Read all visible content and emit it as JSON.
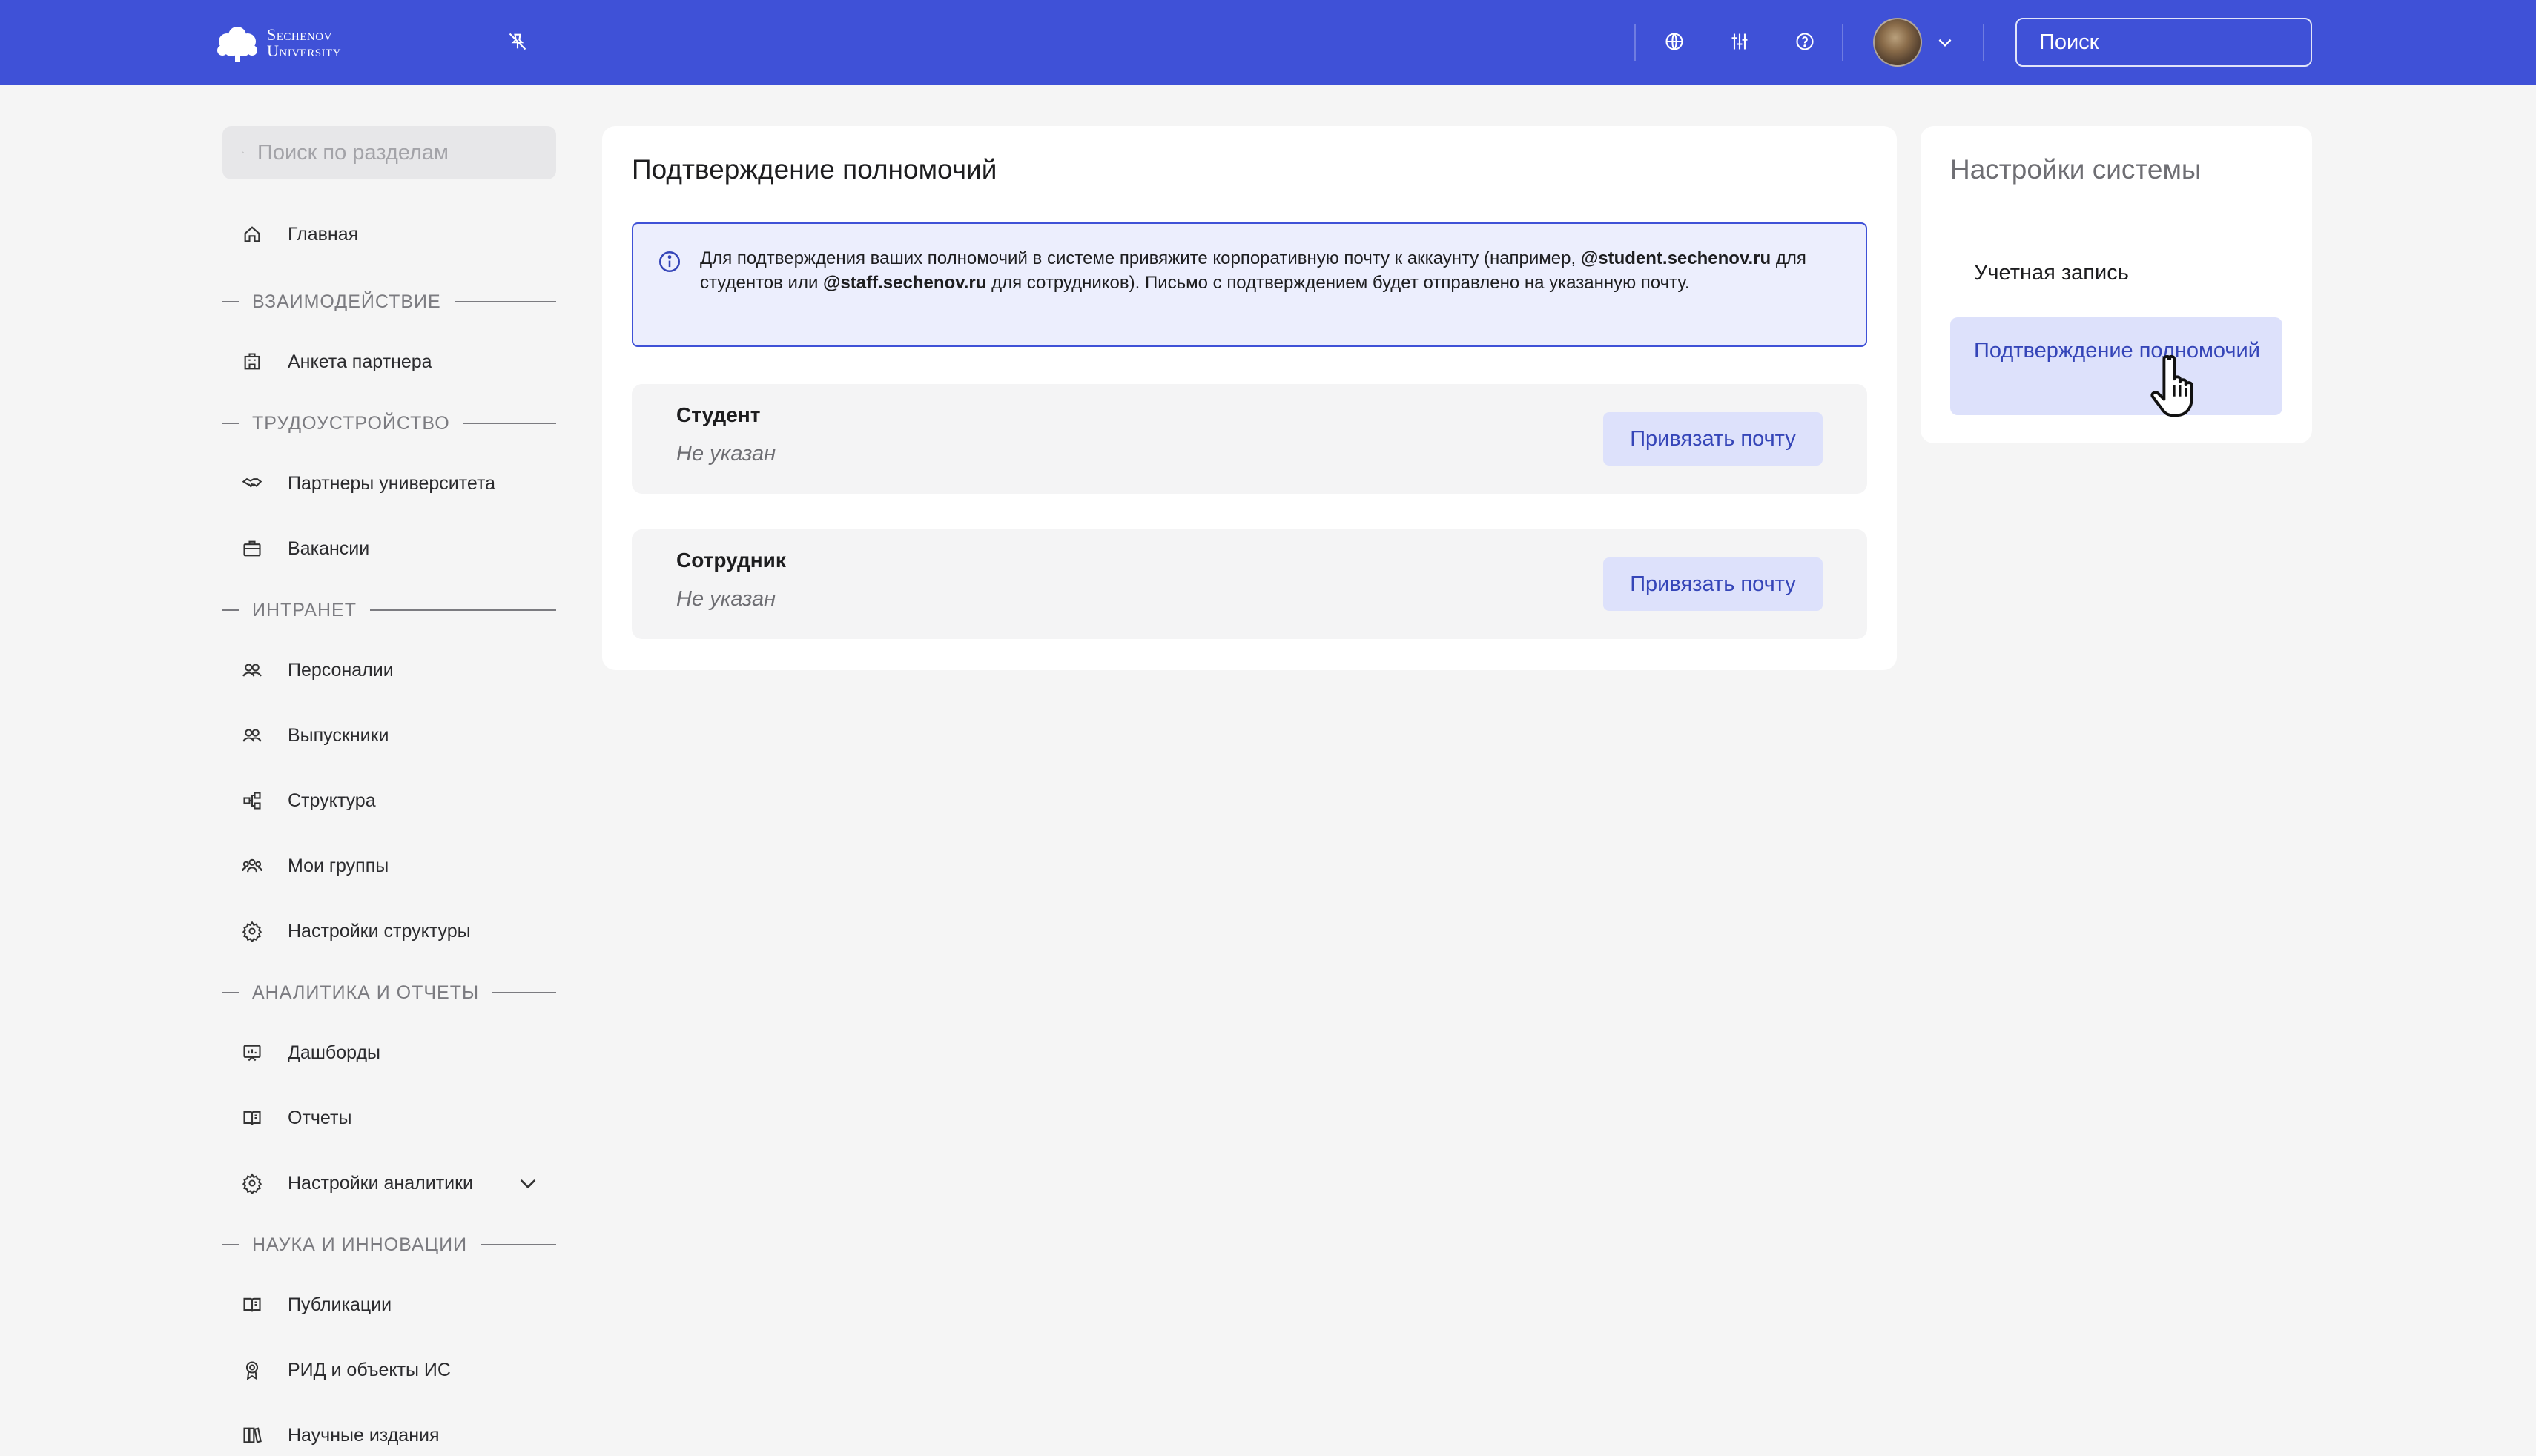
{
  "header": {
    "logo_line1": "Sechenov",
    "logo_line2": "University",
    "search_placeholder": "Поиск",
    "accent_color": "#3f51d7"
  },
  "sidebar": {
    "search_placeholder": "Поиск по разделам",
    "home": {
      "label": "Главная",
      "icon": "home-icon"
    },
    "sections": [
      {
        "title": "ВЗАИМОДЕЙСТВИЕ",
        "items": [
          {
            "label": "Анкета партнера",
            "icon": "building-icon"
          }
        ]
      },
      {
        "title": "ТРУДОУСТРОЙСТВО",
        "items": [
          {
            "label": "Партнеры университета",
            "icon": "handshake-icon"
          },
          {
            "label": "Вакансии",
            "icon": "briefcase-icon"
          }
        ]
      },
      {
        "title": "ИНТРАНЕТ",
        "items": [
          {
            "label": "Персоналии",
            "icon": "people-icon"
          },
          {
            "label": "Выпускники",
            "icon": "people-icon"
          },
          {
            "label": "Структура",
            "icon": "structure-icon"
          },
          {
            "label": "Мои группы",
            "icon": "group-icon"
          },
          {
            "label": "Настройки структуры",
            "icon": "gear-icon"
          }
        ]
      },
      {
        "title": "АНАЛИТИКА И ОТЧЕТЫ",
        "items": [
          {
            "label": "Дашборды",
            "icon": "dashboard-icon"
          },
          {
            "label": "Отчеты",
            "icon": "book-icon"
          },
          {
            "label": "Настройки аналитики",
            "icon": "gear-icon"
          }
        ]
      },
      {
        "title": "НАУКА И ИННОВАЦИИ",
        "items": [
          {
            "label": "Публикации",
            "icon": "book-icon"
          },
          {
            "label": "РИД и объекты ИС",
            "icon": "award-icon"
          },
          {
            "label": "Научные издания",
            "icon": "library-icon"
          }
        ]
      }
    ]
  },
  "main": {
    "title": "Подтверждение полномочий",
    "info": {
      "part1": "Для подтверждения ваших полномочий в системе привяжите корпоративную почту к аккаунту (например, ",
      "student_domain": "@student.sechenov.ru",
      "part2": " для студентов или ",
      "staff_domain": "@staff.sechenov.ru",
      "part3": " для сотрудников). Письмо с подтверждением будет отправлено на указанную почту."
    },
    "roles": [
      {
        "name": "Студент",
        "status": "Не указан",
        "button": "Привязать почту"
      },
      {
        "name": "Сотрудник",
        "status": "Не указан",
        "button": "Привязать почту"
      }
    ]
  },
  "settings_menu": {
    "title": "Настройки системы",
    "items": [
      {
        "label": "Учетная запись",
        "active": false
      },
      {
        "label": "Подтверждение полномочий",
        "active": true
      }
    ]
  }
}
